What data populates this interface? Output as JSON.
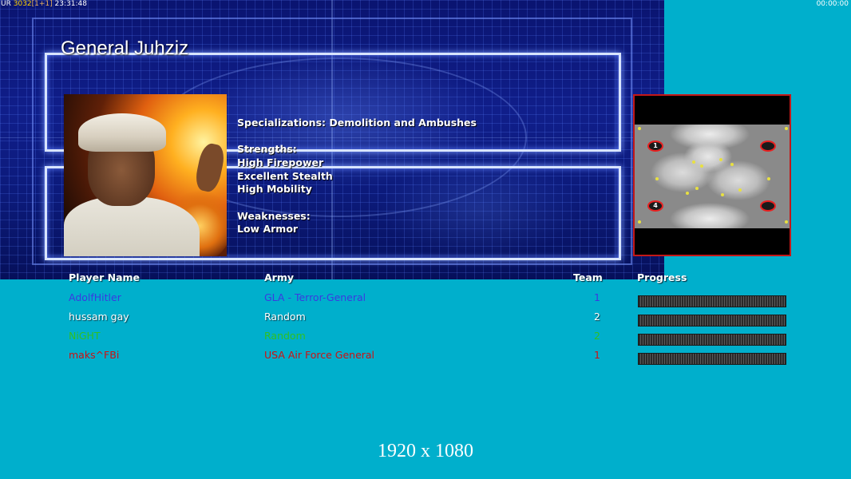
{
  "hud": {
    "prefix": "UR",
    "fps": "30",
    "fps2": "32",
    "tag": "[1+1]",
    "time": "23:31:48",
    "timer": "00:00:00"
  },
  "general": {
    "name": "General Juhziz",
    "specializations": "Specializations: Demolition and Ambushes",
    "strengths_label": "Strengths:",
    "strengths": [
      "High Firepower",
      "Excellent Stealth",
      "High Mobility"
    ],
    "weaknesses_label": "Weaknesses:",
    "weaknesses": [
      "Low Armor"
    ]
  },
  "minimap": {
    "start_labels": [
      "1",
      "",
      "4",
      ""
    ]
  },
  "table": {
    "headers": {
      "name": "Player Name",
      "army": "Army",
      "team": "Team",
      "progress": "Progress"
    },
    "players": [
      {
        "name": "AdolfHitler",
        "army": "GLA - Terror-General",
        "team": "1",
        "color": "#3a3ae0",
        "progress": 0
      },
      {
        "name": "hussam gay",
        "army": "Random",
        "team": "2",
        "color": "#ffffff",
        "progress": 0
      },
      {
        "name": "NiGHT",
        "army": "Random",
        "team": "2",
        "color": "#30c020",
        "progress": 0
      },
      {
        "name": "maks^FBi",
        "army": "USA Air Force General",
        "team": "1",
        "color": "#d01010",
        "progress": 0
      }
    ]
  },
  "resolution": "1920 x 1080"
}
